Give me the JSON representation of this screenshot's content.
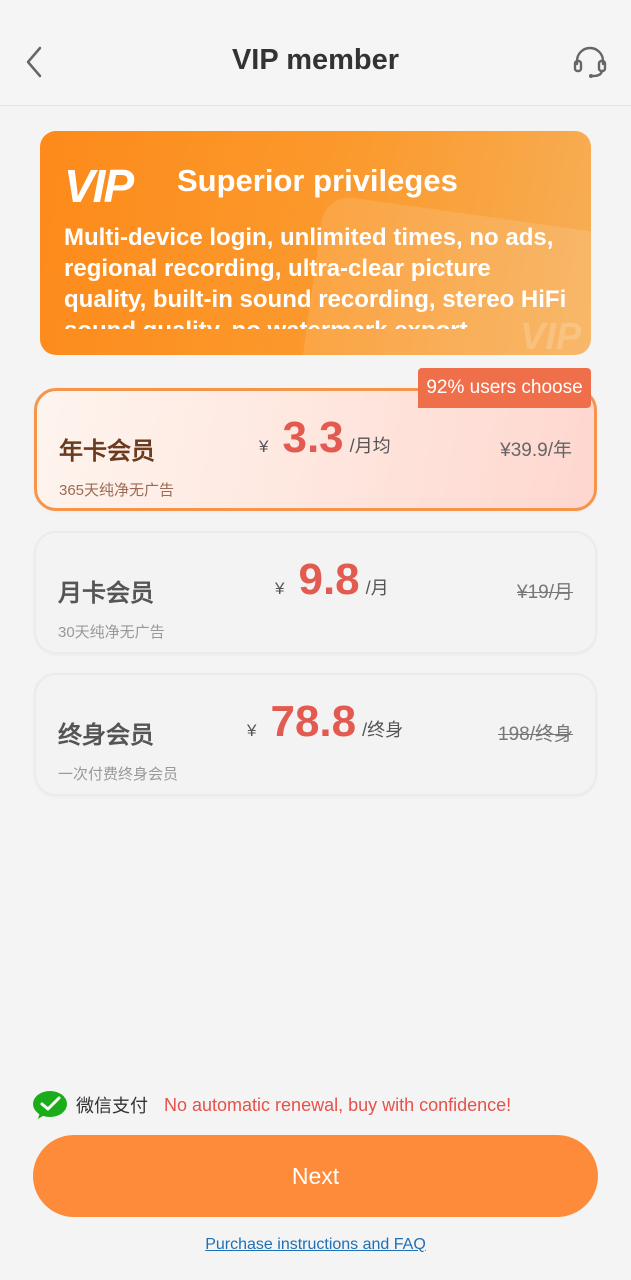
{
  "header": {
    "back_icon": "chevron-left-icon",
    "title": "VIP member",
    "support_icon": "headset-icon"
  },
  "banner": {
    "logo_text": "VIP",
    "title": "Superior privileges",
    "description": "Multi-device login, unlimited times, no ads, regional recording, ultra-clear picture quality, built-in sound recording, stereo HiFi sound quality, no watermark export",
    "deco_text": "VIP",
    "colors": {
      "start": "#fd8a1a",
      "end": "#f7ae56"
    }
  },
  "badge": {
    "label": "92% users choose",
    "color": "#f06f4b"
  },
  "plans": [
    {
      "name": "年卡会员",
      "subtitle": "365天纯净无广告",
      "currency": "¥",
      "price": "3.3",
      "unit": "/月均",
      "original": "¥39.9/年",
      "selected": true
    },
    {
      "name": "月卡会员",
      "subtitle": "30天纯净无广告",
      "currency": "¥",
      "price": "9.8",
      "unit": "/月",
      "original": "¥19/月",
      "selected": false
    },
    {
      "name": "终身会员",
      "subtitle": "一次付费终身会员",
      "currency": "¥",
      "price": "78.8",
      "unit": "/终身",
      "original": "198/终身",
      "selected": false
    }
  ],
  "payment": {
    "icon": "wechat-pay-icon",
    "method_label": "微信支付",
    "note": "No automatic renewal, buy with confidence!"
  },
  "next_button": {
    "label": "Next",
    "color": "#fe8b3a"
  },
  "faq_link": {
    "label": "Purchase instructions and FAQ"
  },
  "colors": {
    "accent": "#fe8b3a",
    "price": "#e25a50",
    "link": "#1e6fb5"
  }
}
